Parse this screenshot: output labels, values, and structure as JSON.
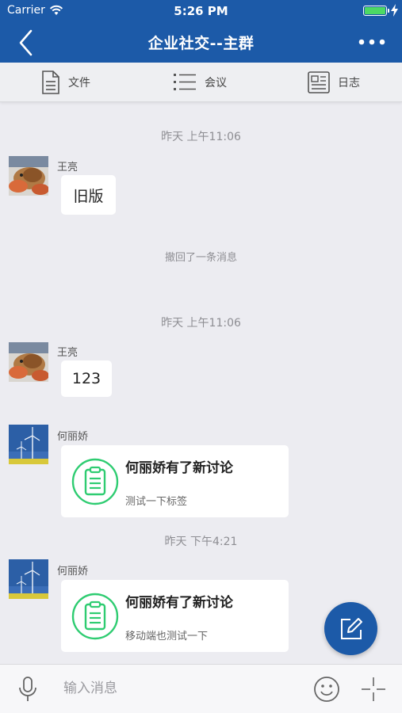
{
  "status_bar": {
    "carrier": "Carrier",
    "time": "5:26 PM"
  },
  "nav": {
    "title": "企业社交--主群"
  },
  "toolbar": {
    "files": "文件",
    "meeting": "会议",
    "log": "日志"
  },
  "messages": {
    "ts1": "昨天 上午11:06",
    "m1": {
      "sender": "王亮",
      "text": "旧版"
    },
    "notice": "撤回了一条消息",
    "ts2": "昨天 上午11:06",
    "m2": {
      "sender": "王亮",
      "text": "123"
    },
    "m3": {
      "sender": "何丽娇",
      "title": "何丽娇有了新讨论",
      "sub": "测试一下标签"
    },
    "ts3": "昨天 下午4:21",
    "m4": {
      "sender": "何丽娇",
      "title": "何丽娇有了新讨论",
      "sub": "移动端也测试一下"
    }
  },
  "input": {
    "placeholder": "输入消息"
  },
  "colors": {
    "brand": "#1c5aa8",
    "card_icon": "#2ecc71",
    "background": "#ececf1"
  }
}
